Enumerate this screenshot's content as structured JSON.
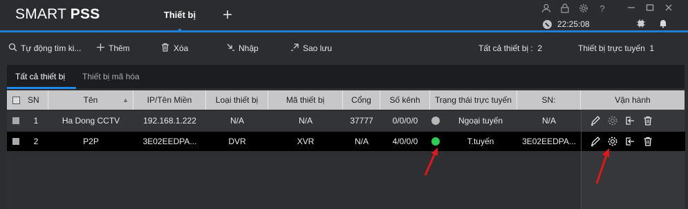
{
  "app": {
    "brand_light": "SMART ",
    "brand_bold": "PSS"
  },
  "tabs": {
    "active": "Thiết bị",
    "add_icon": "plus-icon"
  },
  "window_icons": [
    "user-icon",
    "lock-icon",
    "gear-icon",
    "help-icon",
    "minimize-icon",
    "maximize-icon",
    "close-icon"
  ],
  "clock": "22:25:08",
  "toolbar": {
    "search_label": "Tự động tìm ki...",
    "add_label": "Thêm",
    "delete_label": "Xóa",
    "import_label": "Nhập",
    "backup_label": "Sao lưu",
    "total_label": "Tất cả thiết bị :",
    "total_value": "2",
    "online_label": "Thiết bị trực tuyến",
    "online_value": "1"
  },
  "subtabs": {
    "all": "Tất cả thiết bị",
    "encoded": "Thiết bị mã hóa"
  },
  "table": {
    "columns": [
      "SN",
      "Tên",
      "IP/Tên Miền",
      "Loại thiết bị",
      "Mã thiết bị",
      "Cổng",
      "Số kênh",
      "Trạng thái trực tuyến",
      "SN:",
      "Vận hành"
    ],
    "rows": [
      {
        "sn": "1",
        "name": "Ha Dong CCTV",
        "ip": "192.168.1.222",
        "type": "N/A",
        "model": "N/A",
        "port": "37777",
        "channels": "0/0/0/0",
        "status": "Ngoại tuyến",
        "status_color": "#b7b7b7",
        "serial": "N/A"
      },
      {
        "sn": "2",
        "name": "P2P",
        "ip": "3E02EEDPA...",
        "type": "DVR",
        "model": "XVR",
        "port": "N/A",
        "channels": "4/0/0/0",
        "status": "T.tuyến",
        "status_color": "#2ecc52",
        "serial": "3E02EEDPA..."
      }
    ]
  },
  "colors": {
    "accent": "#1f88e8",
    "annotation": "#e01818"
  }
}
